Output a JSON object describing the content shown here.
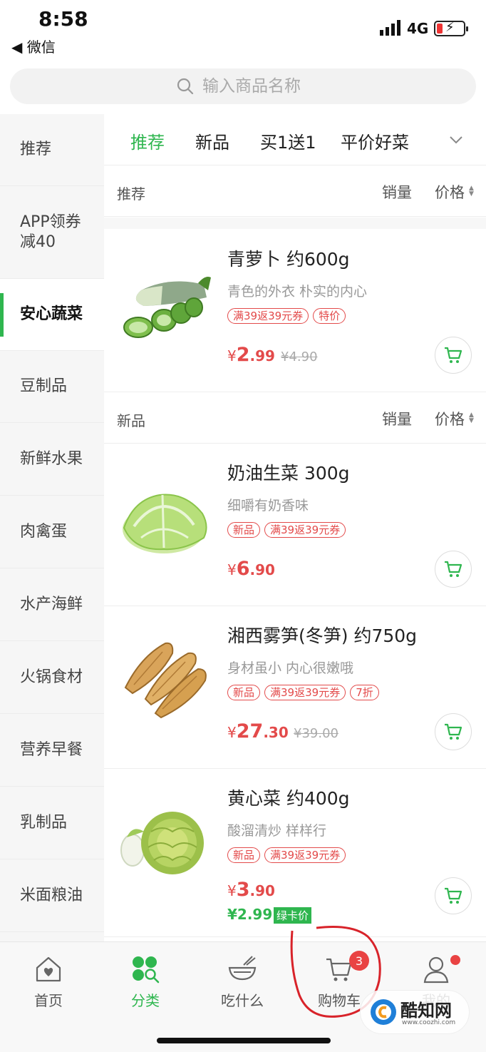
{
  "status": {
    "time": "8:58",
    "back_app": "◀ 微信",
    "network": "4G"
  },
  "search": {
    "placeholder": "输入商品名称"
  },
  "sidebar": {
    "items": [
      {
        "label": "推荐"
      },
      {
        "label": "APP领券减40"
      },
      {
        "label": "安心蔬菜",
        "active": true
      },
      {
        "label": "豆制品"
      },
      {
        "label": "新鲜水果"
      },
      {
        "label": "肉禽蛋"
      },
      {
        "label": "水产海鲜"
      },
      {
        "label": "火锅食材"
      },
      {
        "label": "营养早餐"
      },
      {
        "label": "乳制品"
      },
      {
        "label": "米面粮油"
      }
    ]
  },
  "tabs": [
    {
      "label": "推荐",
      "active": true
    },
    {
      "label": "新品"
    },
    {
      "label": "买1送1"
    },
    {
      "label": "平价好菜"
    }
  ],
  "sections": [
    {
      "title": "推荐",
      "sort_sales": "销量",
      "sort_price": "价格"
    },
    {
      "title": "新品",
      "sort_sales": "销量",
      "sort_price": "价格"
    }
  ],
  "products": [
    {
      "name": "青萝卜 约600g",
      "desc": "青色的外衣 朴实的内心",
      "tags": [
        "满39返39元券",
        "特价"
      ],
      "price_symbol": "¥",
      "price_int": "2",
      "price_dec": ".99",
      "orig_price": "¥4.90",
      "image": "green-radish"
    },
    {
      "name": "奶油生菜 300g",
      "desc": "细嚼有奶香味",
      "tags": [
        "新品",
        "满39返39元券"
      ],
      "price_symbol": "¥",
      "price_int": "6",
      "price_dec": ".90",
      "image": "butter-lettuce"
    },
    {
      "name": "湘西雾笋(冬笋) 约750g",
      "desc": "身材虽小 内心很嫩哦",
      "tags": [
        "新品",
        "满39返39元券",
        "7折"
      ],
      "price_symbol": "¥",
      "price_int": "27",
      "price_dec": ".30",
      "orig_price": "¥39.00",
      "image": "bamboo-shoots"
    },
    {
      "name": "黄心菜 约400g",
      "desc": "酸溜清炒 样样行",
      "tags": [
        "新品",
        "满39返39元券"
      ],
      "price_symbol": "¥",
      "price_int": "3",
      "price_dec": ".90",
      "member_price": "¥2.99",
      "member_label": "绿卡价",
      "image": "yellow-cabbage"
    }
  ],
  "bottom_nav": [
    {
      "label": "首页",
      "icon": "home-icon"
    },
    {
      "label": "分类",
      "icon": "category-icon",
      "active": true
    },
    {
      "label": "吃什么",
      "icon": "bowl-icon"
    },
    {
      "label": "购物车",
      "icon": "cart-icon",
      "badge": "3"
    },
    {
      "label": "我的",
      "icon": "user-icon"
    }
  ],
  "watermark": {
    "name": "酷知网",
    "url": "www.coozhi.com"
  },
  "colors": {
    "accent": "#2fb64f",
    "price": "#e34a4a",
    "badge": "#e94343"
  }
}
